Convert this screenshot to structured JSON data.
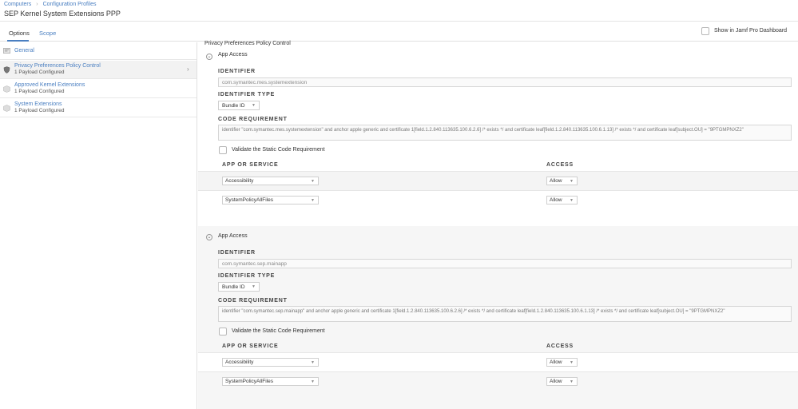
{
  "breadcrumb": {
    "items": [
      "Computers",
      "Configuration Profiles"
    ]
  },
  "page": {
    "title": "SEP Kernel System Extensions PPP"
  },
  "tabs": [
    {
      "label": "Options"
    },
    {
      "label": "Scope"
    }
  ],
  "dashboard": {
    "label": "Show in Jamf Pro Dashboard"
  },
  "sidebar": {
    "items": [
      {
        "title": "General",
        "subtitle": ""
      },
      {
        "title": "Privacy Preferences Policy Control",
        "subtitle": "1 Payload Configured"
      },
      {
        "title": "Approved Kernel Extensions",
        "subtitle": "1 Payload Configured"
      },
      {
        "title": "System Extensions",
        "subtitle": "1 Payload Configured"
      }
    ]
  },
  "main": {
    "section_title": "Privacy Preferences Policy Control",
    "labels": {
      "identifier": "IDENTIFIER",
      "identifier_type": "IDENTIFIER TYPE",
      "code_requirement": "CODE REQUIREMENT",
      "validate": "Validate the Static Code Requirement",
      "app_or_service": "APP OR SERVICE",
      "access": "ACCESS"
    },
    "blocks": [
      {
        "title": "App Access",
        "identifier": "com.symantec.mes.systemextension",
        "identifier_type": "Bundle ID",
        "code_requirement": "identifier \"com.symantec.mes.systemextension\" and anchor apple generic and certificate 1[field.1.2.840.113635.100.6.2.6] /* exists */ and certificate leaf[field.1.2.840.113635.100.6.1.13] /* exists */ and certificate leaf[subject.OU] = \"9PTGMPNXZ2\"",
        "services": [
          {
            "service": "Accessibility",
            "access": "Allow"
          },
          {
            "service": "SystemPolicyAllFiles",
            "access": "Allow"
          }
        ]
      },
      {
        "title": "App Access",
        "identifier": "com.symantec.sep.mainapp",
        "identifier_type": "Bundle ID",
        "code_requirement": "identifier \"com.symantec.sep.mainapp\" and anchor apple generic and certificate 1[field.1.2.840.113635.100.6.2.6] /* exists */ and certificate leaf[field.1.2.840.113635.100.6.1.13] /* exists */ and certificate leaf[subject.OU] = \"9PTGMPNXZ2\"",
        "services": [
          {
            "service": "Accessibility",
            "access": "Allow"
          },
          {
            "service": "SystemPolicyAllFiles",
            "access": "Allow"
          }
        ]
      }
    ]
  },
  "colors": {
    "link": "#4a7fc1",
    "selected_row": "#f2f2f2"
  },
  "icons": [
    "general-icon",
    "shield-icon",
    "extension-icon",
    "extension-icon",
    "chevron-right-icon",
    "collapse-icon",
    "dropdown-arrow-icon"
  ]
}
